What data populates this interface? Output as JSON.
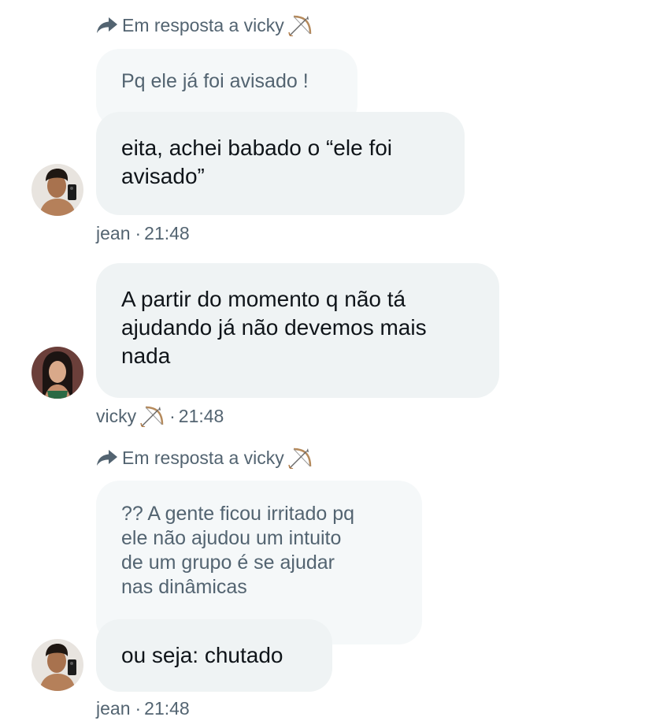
{
  "messages": [
    {
      "reply_hint": "Em resposta a vicky",
      "quoted_text": "Pq ele já foi avisado !",
      "text": "eita, achei babado o “ele foi\navisado”",
      "author": "jean",
      "separator": "·",
      "time": "21:48"
    },
    {
      "text": "A partir do momento q não tá\najudando já não devemos mais\nnada",
      "author": "vicky",
      "separator": "·",
      "time": "21:48"
    },
    {
      "reply_hint": "Em resposta a vicky",
      "quoted_text": "?? A gente ficou irritado pq\nele não ajudou um intuito\nde um grupo é se ajudar\nnas dinâmicas",
      "text": "ou seja: chutado",
      "author": "jean",
      "separator": "·",
      "time": "21:48"
    }
  ],
  "icons": {
    "reply": "reply-arrow-icon",
    "emoji": "bow-and-arrow-emoji"
  },
  "colors": {
    "bubble": "#eff3f4",
    "quoted": "#f5f8f9",
    "text": "#0f1419",
    "secondary": "#536471"
  }
}
